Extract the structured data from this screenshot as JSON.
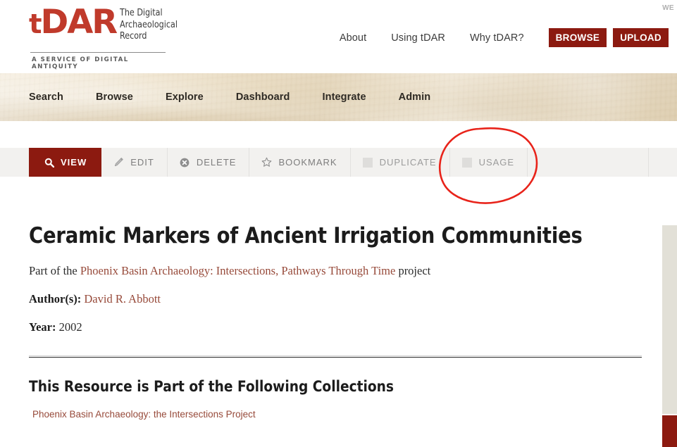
{
  "site": {
    "logo": {
      "mark_t": "t",
      "mark_dar": "DAR",
      "tagline_line1": "The Digital",
      "tagline_line2": "Archaeological",
      "tagline_line3": "Record",
      "subtitle": "A SERVICE OF DIGITAL ANTIQUITY"
    },
    "corner_label": "WE",
    "accent_color": "#8c1a10",
    "logo_color": "#c03a2b",
    "nav_bar_color": "#e9dcc2",
    "link_color": "#974a3a"
  },
  "header_nav": {
    "links": [
      {
        "label": "About"
      },
      {
        "label": "Using tDAR"
      },
      {
        "label": "Why tDAR?"
      }
    ],
    "buttons": [
      {
        "label": "BROWSE"
      },
      {
        "label": "UPLOAD"
      }
    ]
  },
  "main_nav": {
    "items": [
      {
        "label": "Search"
      },
      {
        "label": "Browse"
      },
      {
        "label": "Explore"
      },
      {
        "label": "Dashboard"
      },
      {
        "label": "Integrate"
      },
      {
        "label": "Admin"
      }
    ]
  },
  "toolbar": {
    "items": [
      {
        "label": "VIEW",
        "icon": "magnifier-icon",
        "state": "active"
      },
      {
        "label": "EDIT",
        "icon": "pencil-icon",
        "state": "enabled"
      },
      {
        "label": "DELETE",
        "icon": "circle-x-icon",
        "state": "enabled"
      },
      {
        "label": "BOOKMARK",
        "icon": "star-icon",
        "state": "enabled"
      },
      {
        "label": "DUPLICATE",
        "icon": "placeholder-icon",
        "state": "disabled"
      },
      {
        "label": "USAGE",
        "icon": "placeholder-icon",
        "state": "disabled"
      }
    ]
  },
  "annotation": {
    "shape": "hand-drawn-ellipse",
    "color": "#e8231a",
    "target": "USAGE"
  },
  "resource": {
    "title": "Ceramic Markers of Ancient Irrigation Communities",
    "project_prefix": "Part of the ",
    "project_name": "Phoenix Basin Archaeology: Intersections, Pathways Through Time",
    "project_suffix": " project",
    "authors_label": "Author(s):",
    "authors_value": "David R. Abbott",
    "year_label": "Year:",
    "year_value": "2002"
  },
  "collections": {
    "heading": "This Resource is Part of the Following Collections",
    "items": [
      {
        "label": "Phoenix Basin Archaeology: the Intersections Project"
      }
    ]
  }
}
